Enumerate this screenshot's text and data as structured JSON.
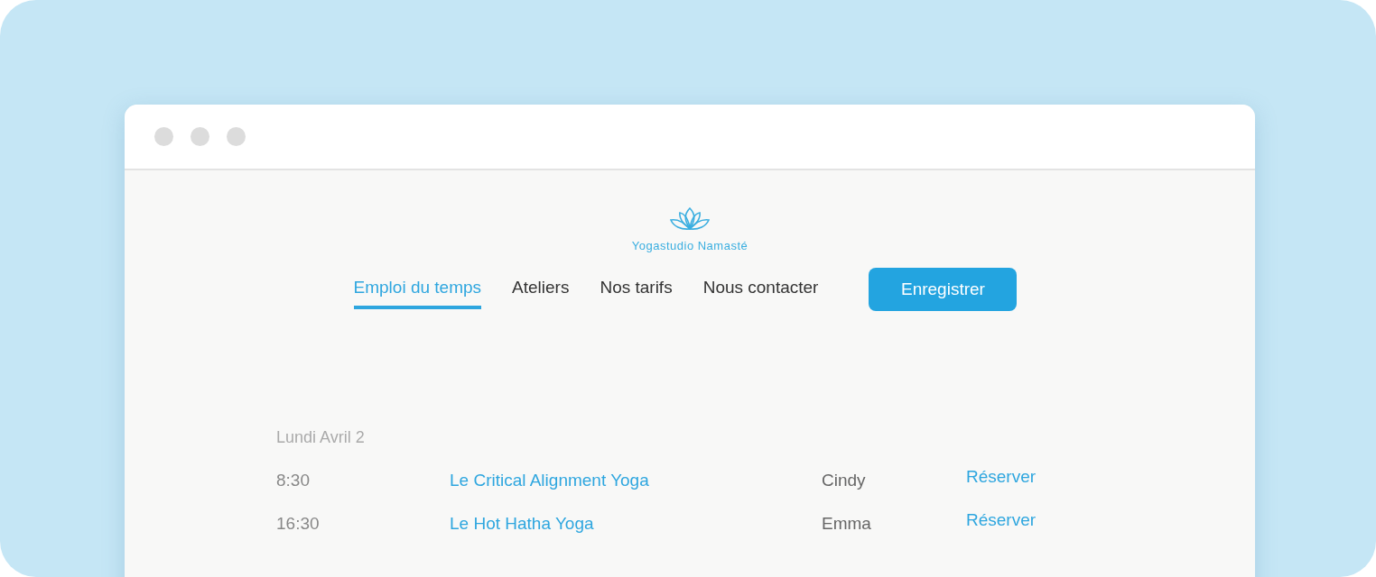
{
  "brand": {
    "name": "Yogastudio Namasté"
  },
  "nav": [
    {
      "label": "Emploi du temps",
      "selected": true
    },
    {
      "label": "Ateliers",
      "selected": false
    },
    {
      "label": "Nos tarifs",
      "selected": false
    },
    {
      "label": "Nous contacter",
      "selected": false
    }
  ],
  "register_button": "Enregistrer",
  "schedule": {
    "date": "Lundi Avril 2",
    "rows": [
      {
        "time": "8:30",
        "class": "Le Critical Alignment Yoga",
        "teacher": "Cindy",
        "action": "Réserver"
      },
      {
        "time": "16:30",
        "class": "Le Hot Hatha Yoga",
        "teacher": "Emma",
        "action": "Réserver"
      }
    ]
  }
}
